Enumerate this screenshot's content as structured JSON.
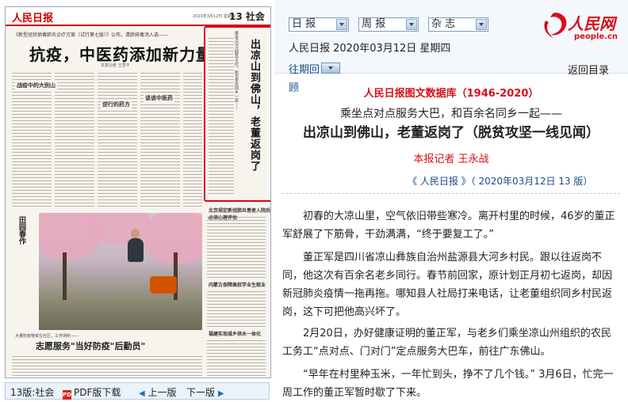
{
  "newspaper": {
    "logo": "人民日报",
    "date_line": "2020年3月12日 星期四",
    "page_label": "13 社会",
    "kicker": "《新型冠状病毒肺炎诊疗方案（试行第七版）》公布，清肺排毒汤入选——",
    "headline": "抗疫，中医药添加新力量",
    "byline": "本报记者 王君平",
    "sub1": "战疫中的大别山",
    "sub2": "逆行的药方",
    "sub3": "谈谈中医药",
    "highlight_sub": "乘坐点对点服务大巴，和百余名同乡一起——",
    "highlight_title": "出凉山到佛山，老董返岗了",
    "photo_caption": "田园春作",
    "right_title1": "北京规定新冠肺炎患者入院后必须心理评估",
    "right_title2": "内蒙古保障高校学业生就业",
    "right_title3": "福建实现城乡供水一体化",
    "kicker2": "大量防疫物资在社区，工作场所——",
    "headline2": "志愿服务\"当好防疫\"后勤员\"",
    "caption_credit": "新华社记者 摄"
  },
  "bottom_bar": {
    "page": "13版:社会",
    "pdf": "PDF版下载",
    "prev": "上一版",
    "next": "下一版",
    "prev_arrow": "◀",
    "next_arrow": "▶"
  },
  "selects": {
    "daily": "日 报",
    "weekly": "周 报",
    "magazine": "杂 志"
  },
  "logo": {
    "name": "人民网",
    "url": "people.cn"
  },
  "issue_line": "人民日报 2020年03月12日 星期四",
  "past_label": "往期回",
  "gu_label": "顾",
  "back_label": "返回目录",
  "database_label": "人民日报图文数据库（1946-2020）",
  "article": {
    "subtitle": "乘坐点对点服务大巴，和百余名同乡一起——",
    "title": "出凉山到佛山，老董返岗了（脱贫攻坚一线见闻）",
    "author": "本报记者 王永战",
    "source": "《 人民日报 》（ 2020年03月12日   13 版）",
    "paragraphs": [
      "初春的大凉山里，空气依旧带些寒冷。离开村里的时候，46岁的董正军舒展了下筋骨，干劲满满，“终于要复工了。”",
      "董正军是四川省凉山彝族自治州盐源县大河乡村民。跟以往返岗不同，他这次有百余名老乡同行。春节前回家，原计划正月初七返岗，却因新冠肺炎疫情一拖再拖。哪知县人社局打来电话，让老董组织同乡村民返岗，这下可把他高兴坏了。",
      "2月20日，办好健康证明的董正军，与老乡们乘坐凉山州组织的农民工务工“点对点、门对门”定点服务大巴车，前往广东佛山。",
      "“早年在村里种玉米，一年忙到头，挣不了几个钱。” 3月6日，忙完一周工作的董正军暂时歇了下来。"
    ]
  },
  "colors": {
    "accent_red": "#d4111a",
    "link_blue": "#1a4c8c",
    "highlight_border": "#e0001b"
  },
  "icons": [
    "pdf-icon",
    "chevron-down-icon",
    "people-logo-icon"
  ]
}
